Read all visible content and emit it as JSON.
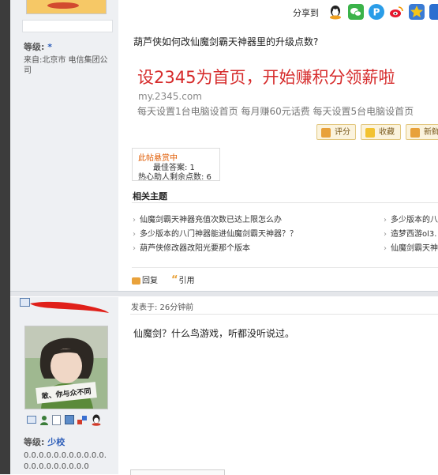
{
  "post1": {
    "user_level_label": "等级:",
    "user_level_value": "*",
    "user_from": "来自:北京市 电信集团公司",
    "share_label": "分享到",
    "title": "葫芦侠如何改仙魔剑霸天神器里的升级点数?",
    "ad_headline": "设2345为首页，开始赚积分领薪啦",
    "ad_url": "my.2345.com",
    "ad_subline": "每天设置1台电脑设首页 每月赚60元话费 每天设置5台电脑设首页",
    "btn_rate": "评分",
    "btn_fav": "收藏",
    "btn_new": "新鲜",
    "bounty_title": "此帖悬赏中",
    "bounty_best": "最佳答案: 1",
    "bounty_hot": "热心助人剩余点数: 6",
    "related_heading": "相关主题",
    "related": [
      "仙魔剑霸天神器充值次数已达上限怎么办",
      "多少版本的八门神器能进仙魔剑霸天神器？？",
      "葫芦侠修改器改阳光要那个版本"
    ],
    "related_right": [
      "多少版本的八",
      "造梦西游ol3.",
      "仙魔剑霸天神"
    ],
    "reply_label": "回复",
    "quote_label": "引用"
  },
  "post2": {
    "avatar_caption": "敢、你与众不同",
    "posted_time": "发表于: 26分钟前",
    "content": "仙魔剑？什么鸟游戏，听都没听说过。",
    "user_level_label": "等级:",
    "user_level_value": "少校",
    "user_dots": "0.0.0.0.0.0.0.0.0.0.0.0.0.0.0.0.0.0.0.0"
  },
  "colors": {
    "ad_red": "#d62b2b",
    "link_blue": "#2b5cb8",
    "bounty_orange": "#e05a00"
  }
}
